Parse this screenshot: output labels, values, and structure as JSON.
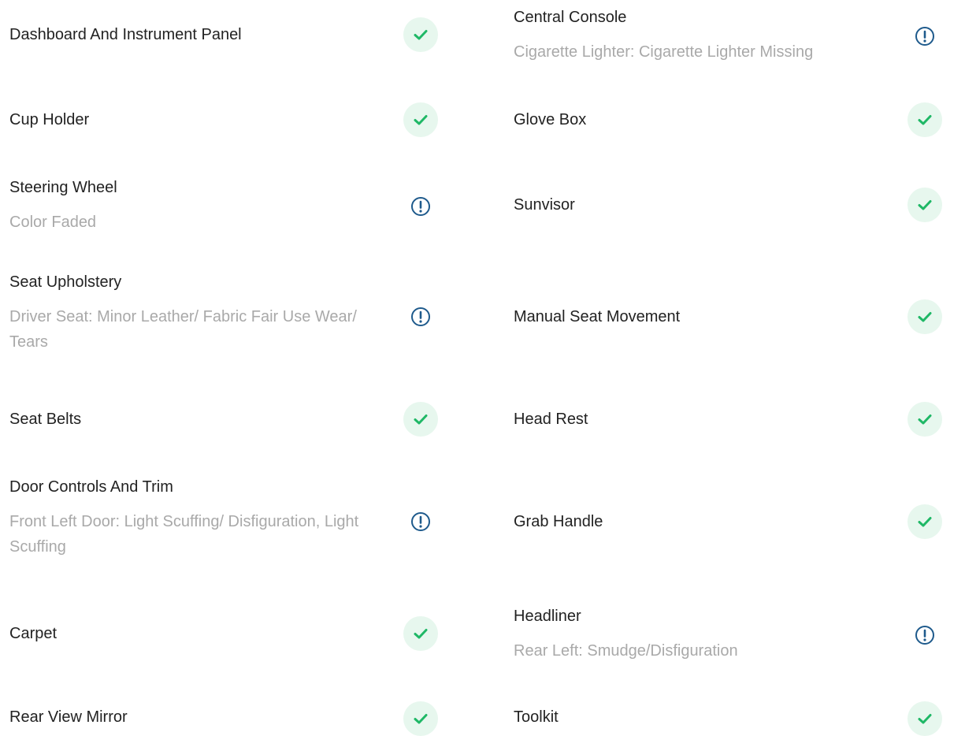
{
  "status_colors": {
    "ok_icon": "#1fb866",
    "ok_bg": "#e7f7ee",
    "warn_icon": "#1e5a8c"
  },
  "left_items": [
    {
      "title": "Dashboard And Instrument Panel",
      "note": "",
      "status": "ok",
      "icon": "check-icon"
    },
    {
      "title": "Cup Holder",
      "note": "",
      "status": "ok",
      "icon": "check-icon"
    },
    {
      "title": "Steering Wheel",
      "note": "Color Faded",
      "status": "warn",
      "icon": "exclamation-icon"
    },
    {
      "title": "Seat Upholstery",
      "note": "Driver Seat: Minor Leather/ Fabric Fair Use Wear/ Tears",
      "status": "warn",
      "icon": "exclamation-icon"
    },
    {
      "title": "Seat Belts",
      "note": "",
      "status": "ok",
      "icon": "check-icon"
    },
    {
      "title": "Door Controls And Trim",
      "note": "Front Left Door: Light Scuffing/ Disfiguration, Light Scuffing",
      "status": "warn",
      "icon": "exclamation-icon"
    },
    {
      "title": "Carpet",
      "note": "",
      "status": "ok",
      "icon": "check-icon"
    },
    {
      "title": "Rear View Mirror",
      "note": "",
      "status": "ok",
      "icon": "check-icon"
    }
  ],
  "right_items": [
    {
      "title": "Central Console",
      "note": "Cigarette Lighter: Cigarette Lighter Missing",
      "status": "warn",
      "icon": "exclamation-icon"
    },
    {
      "title": "Glove Box",
      "note": "",
      "status": "ok",
      "icon": "check-icon"
    },
    {
      "title": "Sunvisor",
      "note": "",
      "status": "ok",
      "icon": "check-icon"
    },
    {
      "title": "Manual Seat Movement",
      "note": "",
      "status": "ok",
      "icon": "check-icon"
    },
    {
      "title": "Head Rest",
      "note": "",
      "status": "ok",
      "icon": "check-icon"
    },
    {
      "title": "Grab Handle",
      "note": "",
      "status": "ok",
      "icon": "check-icon"
    },
    {
      "title": "Headliner",
      "note": "Rear Left: Smudge/Disfiguration",
      "status": "warn",
      "icon": "exclamation-icon"
    },
    {
      "title": "Toolkit",
      "note": "",
      "status": "ok",
      "icon": "check-icon"
    }
  ]
}
